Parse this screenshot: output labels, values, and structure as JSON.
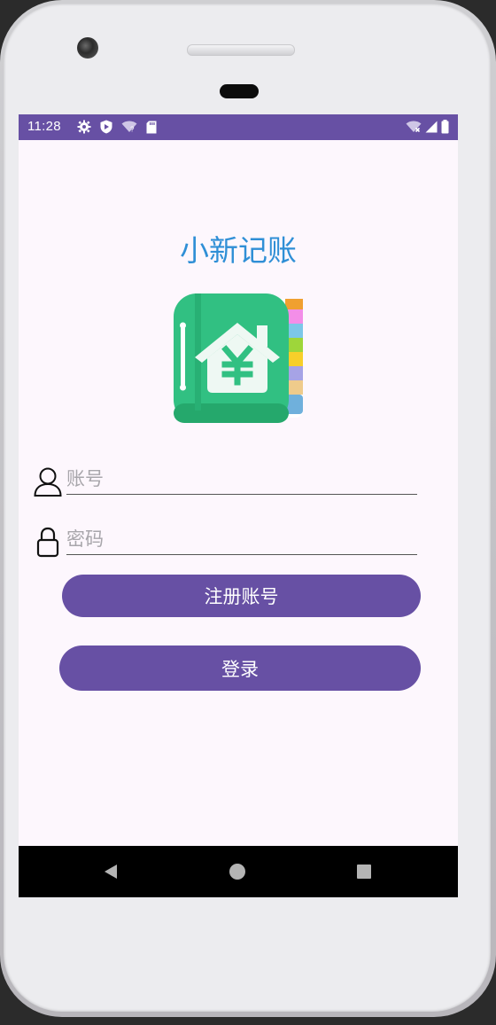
{
  "status_bar": {
    "time": "11:28",
    "background_color": "#6750a4",
    "icons_left": [
      "settings-gear-icon",
      "shield-icon",
      "wifi-question-icon",
      "sd-card-icon"
    ],
    "icons_right": [
      "wifi-x-icon",
      "signal-icon",
      "battery-icon"
    ]
  },
  "app": {
    "title": "小新记账",
    "title_color": "#2f8fd6",
    "logo": "ledger-house-yuan-icon",
    "background_color": "#fdf7fd"
  },
  "login_form": {
    "account": {
      "icon": "user-icon",
      "placeholder": "账号",
      "value": ""
    },
    "password": {
      "icon": "lock-icon",
      "placeholder": "密码",
      "value": ""
    },
    "register_button_label": "注册账号",
    "login_button_label": "登录",
    "button_color": "#6750a4"
  },
  "navigation_bar": {
    "back": "back-triangle-icon",
    "home": "home-circle-icon",
    "recents": "recents-square-icon"
  }
}
